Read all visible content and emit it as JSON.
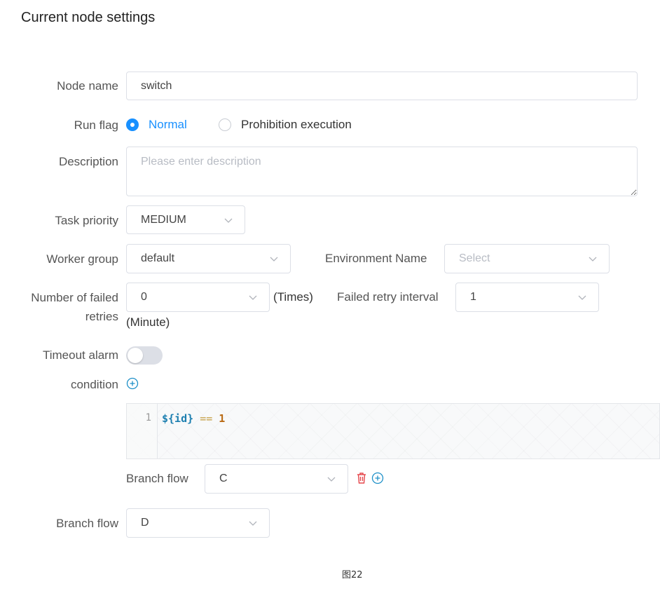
{
  "title": "Current node settings",
  "node_name": {
    "label": "Node name",
    "value": "switch"
  },
  "run_flag": {
    "label": "Run flag",
    "options": [
      "Normal",
      "Prohibition execution"
    ],
    "selected": "Normal"
  },
  "description": {
    "label": "Description",
    "placeholder": "Please enter description"
  },
  "task_priority": {
    "label": "Task priority",
    "value": "MEDIUM"
  },
  "worker_group": {
    "label": "Worker group",
    "value": "default"
  },
  "environment": {
    "label": "Environment Name",
    "placeholder": "Select"
  },
  "failed_retries": {
    "label_line1": "Number of failed",
    "label_line2": "retries",
    "value": "0",
    "unit": "(Times)"
  },
  "retry_interval": {
    "label": "Failed retry interval",
    "value": "1",
    "unit": "(Minute)"
  },
  "timeout_alarm": {
    "label": "Timeout alarm",
    "enabled": false
  },
  "condition": {
    "label": "condition",
    "editor": {
      "line_number": "1",
      "code_var": "${id}",
      "code_op": "==",
      "code_num": "1"
    },
    "branch_label": "Branch flow",
    "branch_value": "C"
  },
  "default_branch": {
    "label": "Branch flow",
    "value": "D"
  },
  "caption": "图22",
  "colors": {
    "accent": "#1890ff",
    "delete": "#e5484d",
    "plus": "#1e90c8"
  }
}
